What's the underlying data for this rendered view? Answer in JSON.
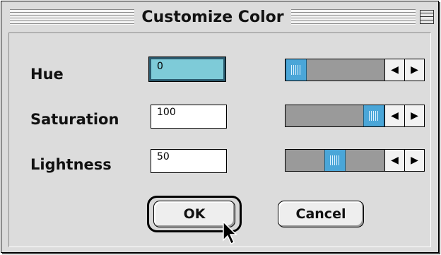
{
  "window": {
    "title": "Customize Color"
  },
  "fields": [
    {
      "label": "Hue",
      "value": "0",
      "slider_fraction": 0.0
    },
    {
      "label": "Saturation",
      "value": "100",
      "slider_fraction": 1.0
    },
    {
      "label": "Lightness",
      "value": "50",
      "slider_fraction": 0.5
    }
  ],
  "icons": {
    "collapse": "collapse-box-icon",
    "left_arrow": "◀",
    "right_arrow": "▶"
  },
  "buttons": {
    "ok": "OK",
    "cancel": "Cancel"
  },
  "colors": {
    "accent": "#4aa6d8",
    "focus_fill": "#7ecbd8"
  }
}
